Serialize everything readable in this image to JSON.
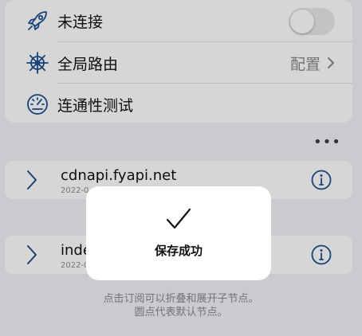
{
  "connection": {
    "label": "未连接",
    "toggle_on": false
  },
  "routing": {
    "label": "全局路由",
    "value": "配置"
  },
  "test": {
    "label": "连通性测试"
  },
  "more_label": "•••",
  "nodes": [
    {
      "name": "cdnapi.fyapi.net",
      "date": "2022-0"
    },
    {
      "name": "inde",
      "date": "2022-0"
    }
  ],
  "footer": {
    "line1": "点击订阅可以折叠和展开子节点。",
    "line2": "圆点代表默认节点。"
  },
  "toast": {
    "message": "保存成功"
  },
  "colors": {
    "accent": "#1e4f8f",
    "background": "#f2f2f7",
    "overlay": "rgba(0,0,0,0.16)"
  }
}
